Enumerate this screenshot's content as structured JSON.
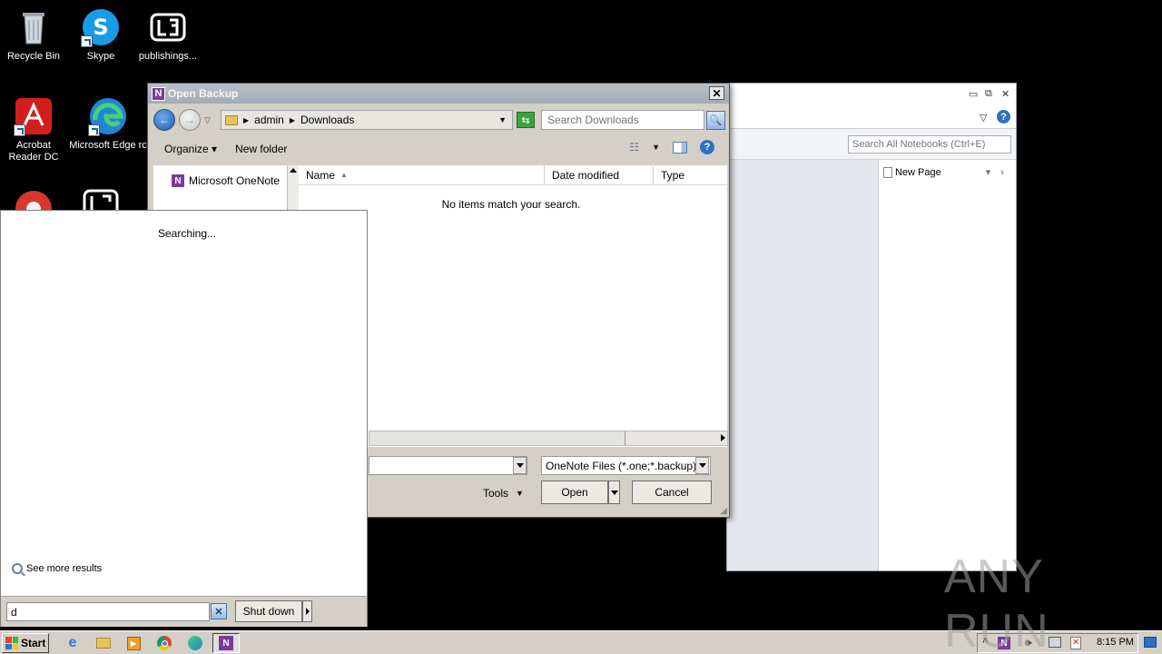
{
  "desktop": {
    "icons": [
      {
        "label": "Recycle Bin"
      },
      {
        "label": "Skype"
      },
      {
        "label": "publishings..."
      },
      {
        "label": "Acrobat Reader DC"
      },
      {
        "label": "Microsoft Edge rc"
      }
    ]
  },
  "onenote": {
    "search_placeholder": "Search All Notebooks (Ctrl+E)",
    "new_page_label": "New Page"
  },
  "dialog": {
    "title": "Open Backup",
    "breadcrumb": [
      "admin",
      "Downloads"
    ],
    "search_placeholder": "Search Downloads",
    "toolbar": {
      "organize": "Organize",
      "new_folder": "New folder"
    },
    "nav_items": [
      {
        "label": "Microsoft OneNote"
      }
    ],
    "columns": [
      "Name",
      "Date modified",
      "Type"
    ],
    "empty_message": "No items match your search.",
    "file_type_filter": "OneNote Files (*.one;*.backup)",
    "tools_label": "Tools",
    "open_label": "Open",
    "cancel_label": "Cancel"
  },
  "start_menu": {
    "status": "Searching...",
    "see_more": "See more results",
    "search_value": "d",
    "shutdown_label": "Shut down"
  },
  "taskbar": {
    "start_label": "Start",
    "clock": "8:15 PM"
  },
  "watermark": "ANY RUN"
}
